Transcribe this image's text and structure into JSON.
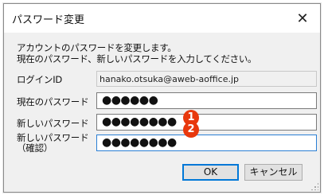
{
  "dialog": {
    "title": "パスワード変更",
    "close_glyph": "✕"
  },
  "description": {
    "line1": "アカウントのパスワードを変更します。",
    "line2": "現在のパスワード、新しいパスワードを入力してください。"
  },
  "fields": {
    "login_id": {
      "label": "ログインID",
      "value": "hanako.otsuka@aweb-aoffice.jp"
    },
    "current_password": {
      "label": "現在のパスワード",
      "value": "●●●●●●"
    },
    "new_password": {
      "label": "新しいパスワード",
      "value": "●●●●●●●●"
    },
    "confirm_password": {
      "label_line1": "新しいパスワード",
      "label_line2": "（確認）",
      "value": "●●●●●●●●"
    }
  },
  "annotations": {
    "badge1": "1",
    "badge2": "2",
    "badge_color": "#e8380d"
  },
  "buttons": {
    "ok": "OK",
    "cancel": "キャンセル"
  }
}
